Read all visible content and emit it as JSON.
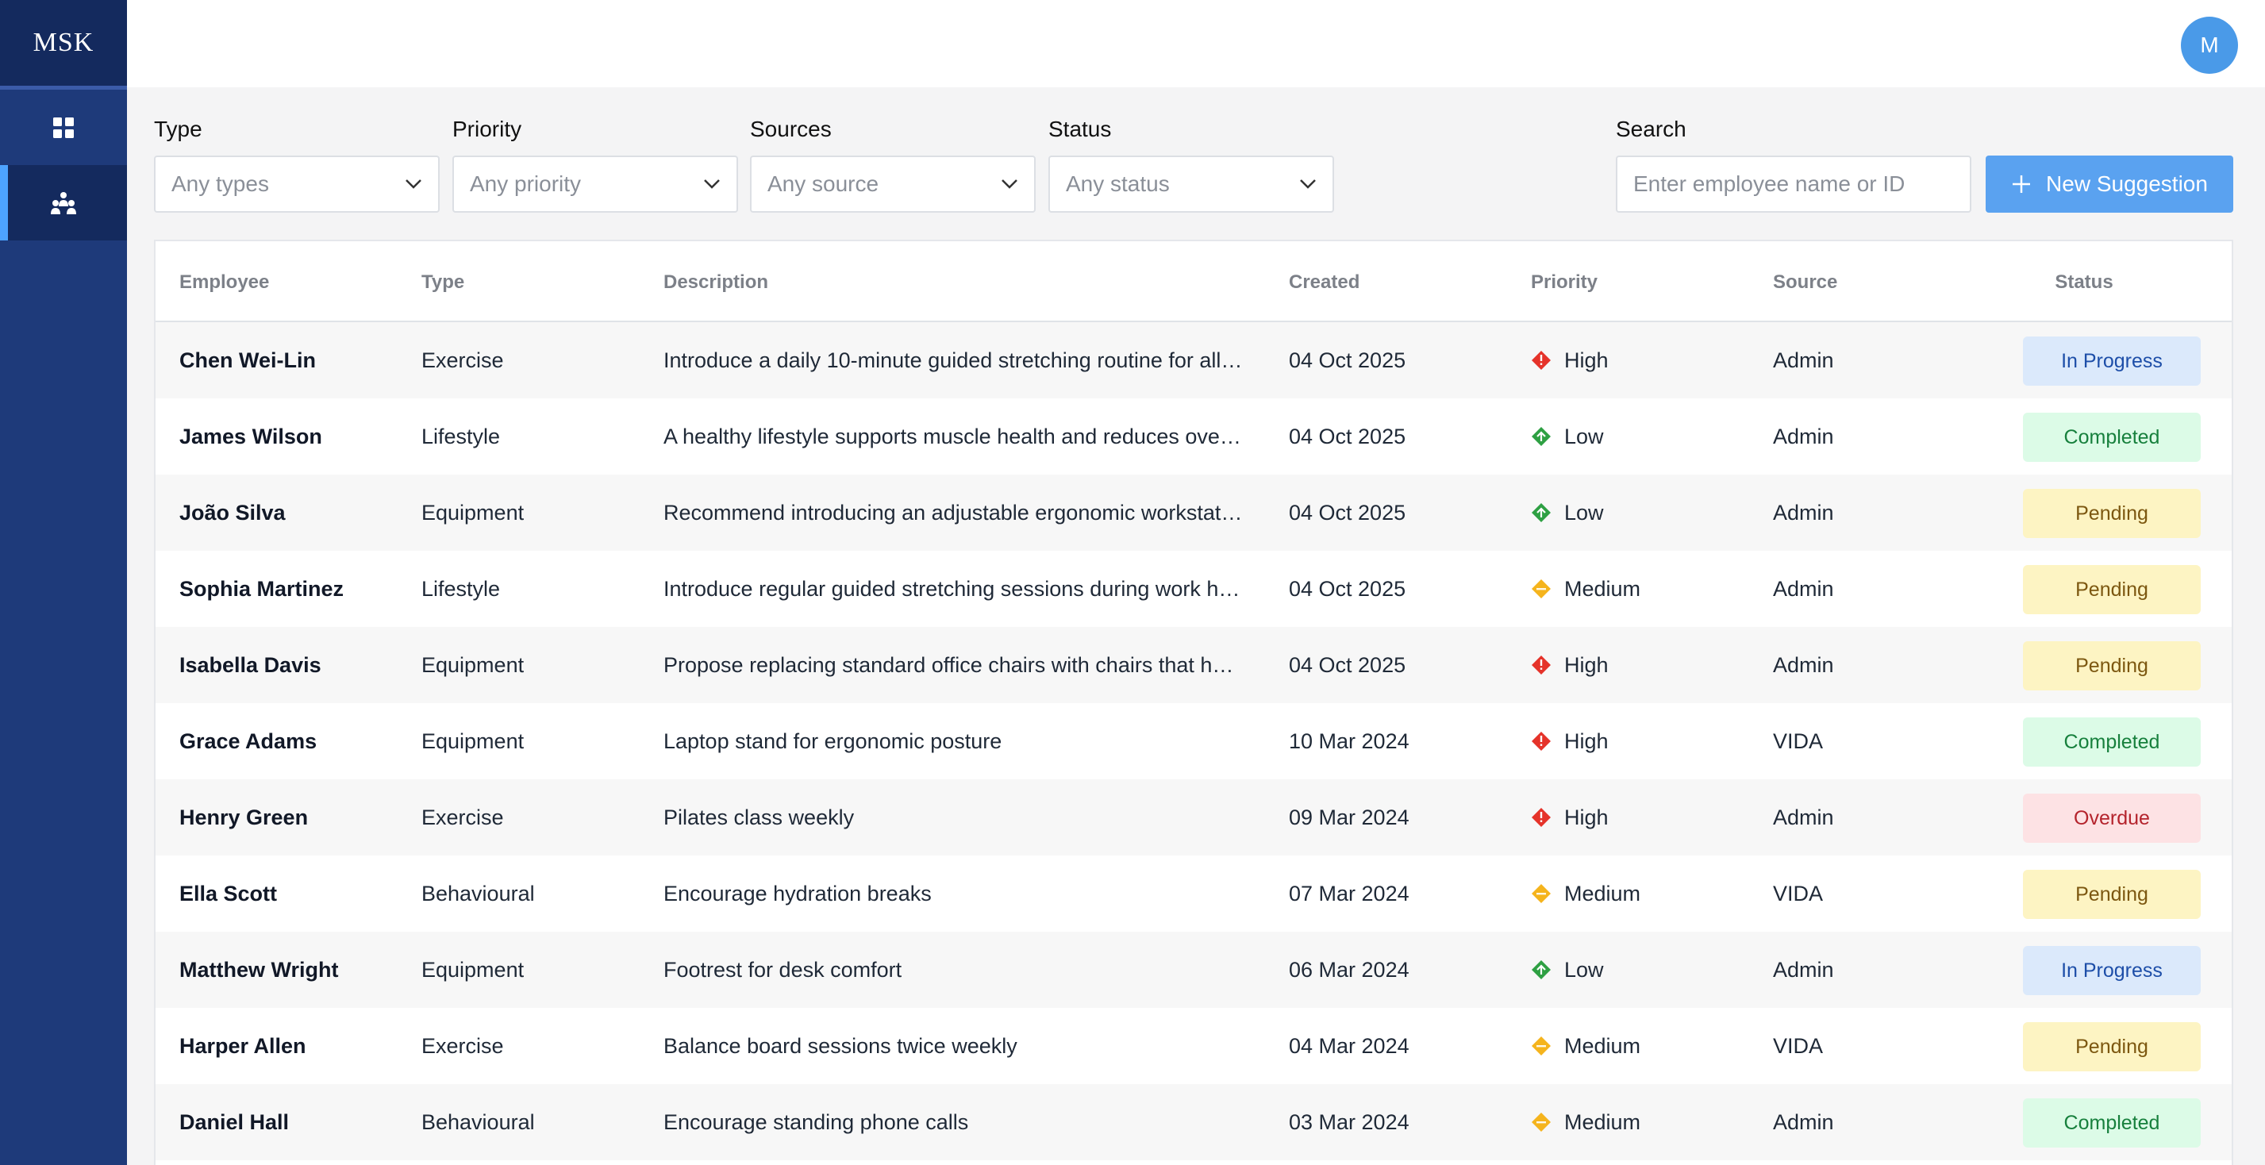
{
  "app": {
    "logo": "MSK",
    "user_initial": "M"
  },
  "sidebar": {
    "items": [
      {
        "icon": "dashboard-icon"
      },
      {
        "icon": "team-icon",
        "active": true
      }
    ]
  },
  "filters": {
    "type": {
      "label": "Type",
      "placeholder": "Any types"
    },
    "priority": {
      "label": "Priority",
      "placeholder": "Any priority"
    },
    "sources": {
      "label": "Sources",
      "placeholder": "Any source"
    },
    "status": {
      "label": "Status",
      "placeholder": "Any status"
    },
    "search": {
      "label": "Search",
      "placeholder": "Enter employee name or ID"
    },
    "new_button": "New Suggestion"
  },
  "colors": {
    "accent": "#5aa2f0",
    "sidebar": "#1e3a7a",
    "priority_high": "#e5332a",
    "priority_medium": "#f5b41d",
    "priority_low": "#2ea043"
  },
  "table": {
    "columns": [
      "Employee",
      "Type",
      "Description",
      "Created",
      "Priority",
      "Source",
      "Status"
    ],
    "rows": [
      {
        "employee": "Chen Wei-Lin",
        "type": "Exercise",
        "description": "Introduce a daily 10-minute guided stretching routine for all …",
        "created": "04 Oct 2025",
        "priority": "High",
        "source": "Admin",
        "status": "In Progress"
      },
      {
        "employee": "James Wilson",
        "type": "Lifestyle",
        "description": "A healthy lifestyle supports muscle health and reduces over…",
        "created": "04 Oct 2025",
        "priority": "Low",
        "source": "Admin",
        "status": "Completed"
      },
      {
        "employee": "João Silva",
        "type": "Equipment",
        "description": "Recommend introducing an adjustable ergonomic workstatio…",
        "created": "04 Oct 2025",
        "priority": "Low",
        "source": "Admin",
        "status": "Pending"
      },
      {
        "employee": "Sophia Martinez",
        "type": "Lifestyle",
        "description": "Introduce regular guided stretching sessions during work ho…",
        "created": "04 Oct 2025",
        "priority": "Medium",
        "source": "Admin",
        "status": "Pending"
      },
      {
        "employee": "Isabella Davis",
        "type": "Equipment",
        "description": "Propose replacing standard office chairs with chairs that hav…",
        "created": "04 Oct 2025",
        "priority": "High",
        "source": "Admin",
        "status": "Pending"
      },
      {
        "employee": "Grace Adams",
        "type": "Equipment",
        "description": "Laptop stand for ergonomic posture",
        "created": "10 Mar 2024",
        "priority": "High",
        "source": "VIDA",
        "status": "Completed"
      },
      {
        "employee": "Henry Green",
        "type": "Exercise",
        "description": "Pilates class weekly",
        "created": "09 Mar 2024",
        "priority": "High",
        "source": "Admin",
        "status": "Overdue"
      },
      {
        "employee": "Ella Scott",
        "type": "Behavioural",
        "description": "Encourage hydration breaks",
        "created": "07 Mar 2024",
        "priority": "Medium",
        "source": "VIDA",
        "status": "Pending"
      },
      {
        "employee": "Matthew Wright",
        "type": "Equipment",
        "description": "Footrest for desk comfort",
        "created": "06 Mar 2024",
        "priority": "Low",
        "source": "Admin",
        "status": "In Progress"
      },
      {
        "employee": "Harper Allen",
        "type": "Exercise",
        "description": "Balance board sessions twice weekly",
        "created": "04 Mar 2024",
        "priority": "Medium",
        "source": "VIDA",
        "status": "Pending"
      },
      {
        "employee": "Daniel Hall",
        "type": "Behavioural",
        "description": "Encourage standing phone calls",
        "created": "03 Mar 2024",
        "priority": "Medium",
        "source": "Admin",
        "status": "Completed"
      }
    ]
  }
}
